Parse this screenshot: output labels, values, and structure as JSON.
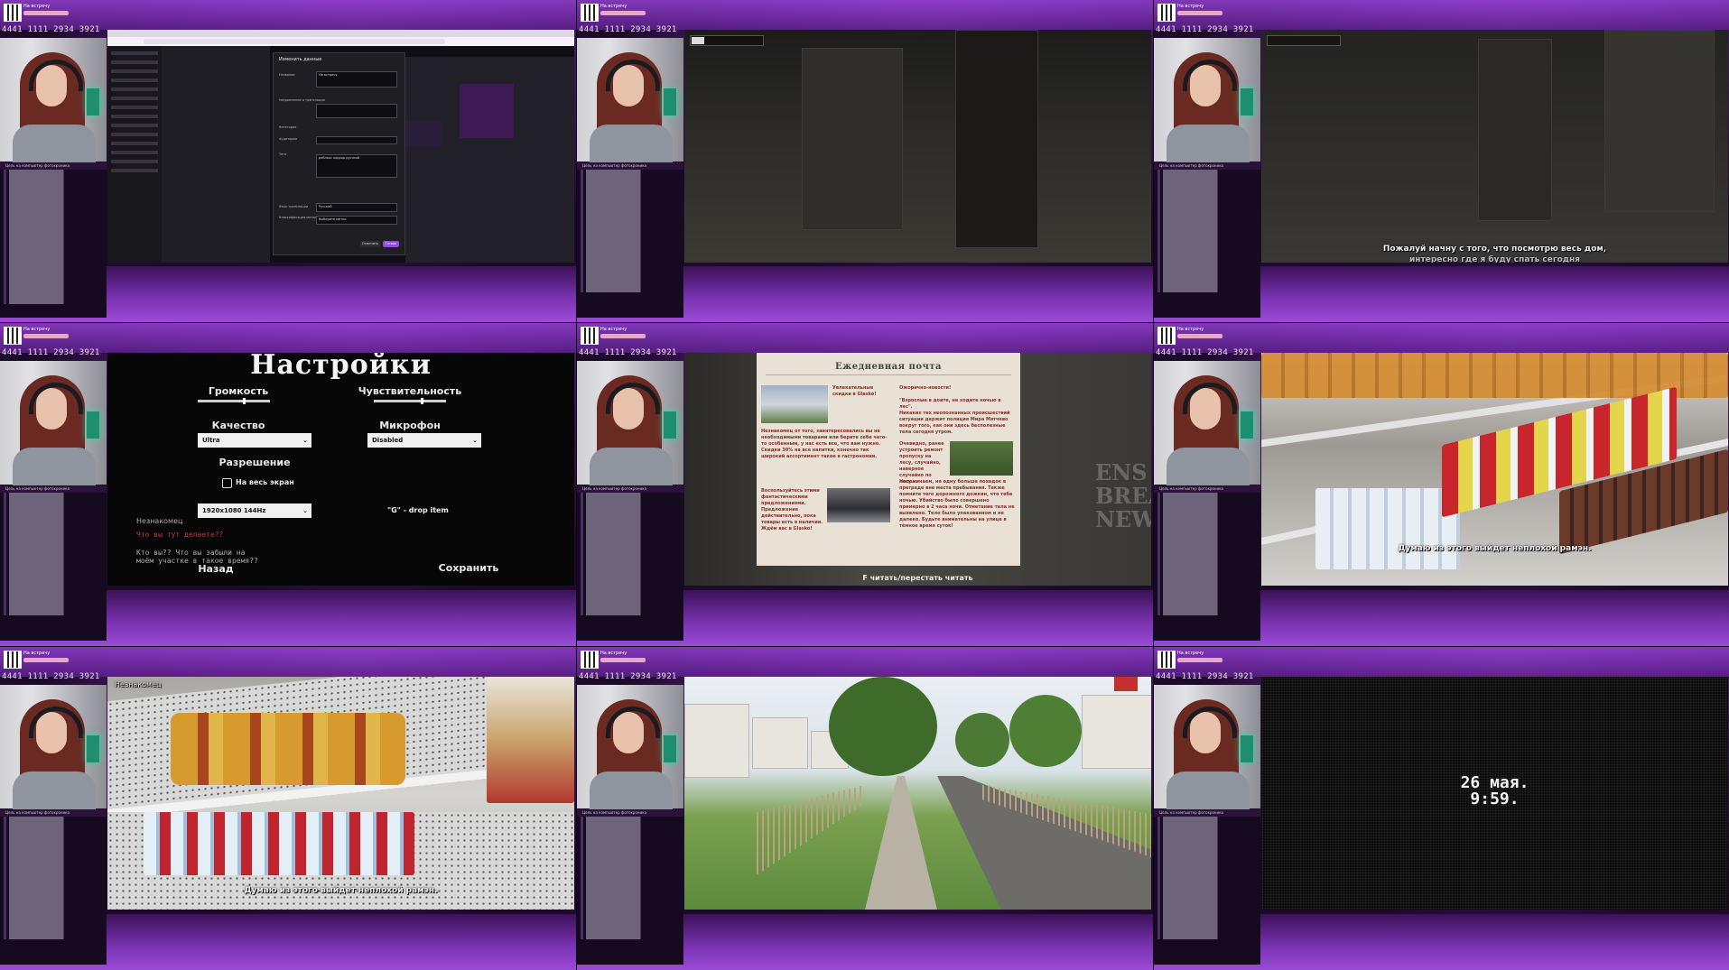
{
  "streamer": {
    "ticker": "4441 1111 2934 3921",
    "stream_title": "На встречу",
    "stream_sub": "Цель на компьютер фотохроника"
  },
  "tiles": [
    {
      "id": "p1",
      "caption": ""
    },
    {
      "id": "p2",
      "caption": ""
    },
    {
      "id": "p3",
      "caption_line1": "Пожалуй начну с того, что посмотрю весь дом,",
      "caption_line2": "интересно где я буду спать сегодня"
    },
    {
      "id": "p4",
      "caption": ""
    },
    {
      "id": "p5",
      "caption": ""
    },
    {
      "id": "p6",
      "caption": "Думаю из этого выйдет неплохой рамэн."
    },
    {
      "id": "p7",
      "caption": "Думаю из этого выйдет неплохой рамэн.",
      "speaker": "Незнакомец"
    },
    {
      "id": "p8",
      "caption": ""
    },
    {
      "id": "p9",
      "caption": ""
    }
  ],
  "browser_modal": {
    "title": "Изменить данные",
    "fields": [
      "Название",
      "Уведомление о трансляции",
      "Категория",
      "Аудитория",
      "Теги",
      "Язык трансляции",
      "Классификация материалов"
    ],
    "name_value": "На встречу",
    "tags": [
      "роблокс",
      "хоррор",
      "русский"
    ],
    "language_value": "Русский",
    "content_value": "Выберите метки",
    "cancel_label": "Отменить",
    "done_label": "Готово"
  },
  "settings": {
    "title": "Настройки",
    "volume_label": "Громкость",
    "sensitivity_label": "Чувствительность",
    "quality_label": "Качество",
    "microphone_label": "Микрофон",
    "quality_value": "Ultra",
    "microphone_value": "Disabled",
    "resolution_label": "Разрешение",
    "fullscreen_label": "На весь экран",
    "resolution_value": "1920x1080 144Hz",
    "drop_hint": "\"G\" - drop item",
    "speaker": "Незнакомец",
    "line_red": "Что вы тут делаете??",
    "line_gray1": "Кто вы?? Что вы забыли на",
    "line_gray2": "моём участке в такое время??",
    "back_label": "Назад",
    "save_label": "Сохранить"
  },
  "newspaper": {
    "title": "Ежедневная почта",
    "col1_head": "Увлекательные скидки в Glasko!",
    "col1_body": "Незнакомец от того, заинтересовались вы не необходимыми товарами или берите себе чего-то особенным, у нас есть все, что вам нужно. Скидки 30% на все напитки, конечно так широкий ассортимент такое в гастрономии.",
    "col1_foot": "Воспользуйтесь этими фантастическими предложениями. Предложение действительно, пока товары есть в наличии. Ждём вас в Glasko!",
    "col2_head": "Ожорично-новости!",
    "col2_quote": "\"Взрослые в доите, не ходите ночью в лес\".",
    "col2_body": "Никаких тех неопознанных происшествий ситуации держит полиция Мира Мятчево вокруг того, как они здесь бесполезные тела сегодня утром.",
    "col2_body2": "Очевидно, ранее устроить ремонт пропуску на лесу, случайно, наверное случайно по лесу...",
    "col2_warn": "Напоминаем, не одну больше походок в преграде вне места пребывания. Также помните того дорожного дожкин, что тебе ночью. Убийство было совершено примерно в 2 часа ночи. Отметание тела не выявлено. Тело было упакованном и не далеко. Будьте внимательны на улице в тёмное время суток!",
    "prompt": "F читать/перестать читать",
    "bignews": "ENS BREAKIN NEWS!"
  },
  "date_screen": {
    "line1": "26 мая.",
    "line2": "9:59."
  },
  "colors": {
    "purple_bg": "#7a2fb1",
    "accent": "#9a4bd6"
  }
}
